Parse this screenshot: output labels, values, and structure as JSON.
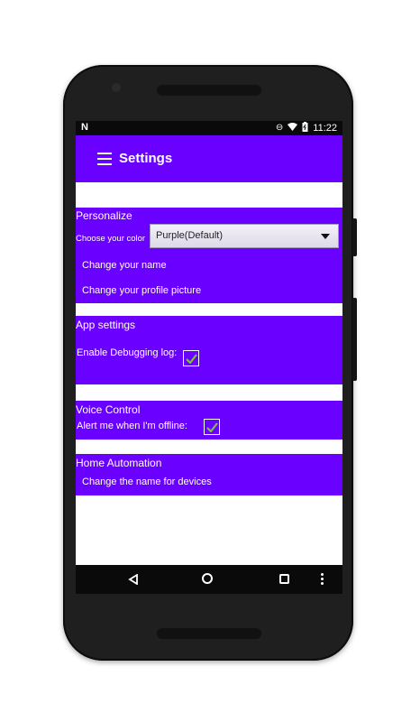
{
  "status_bar": {
    "notification_icon": "N",
    "icons": [
      "do-not-disturb-icon",
      "wifi-icon",
      "battery-icon"
    ],
    "time": "11:22"
  },
  "app_bar": {
    "title": "Settings",
    "menu_icon": "hamburger-menu-icon",
    "background": "#6a00ff"
  },
  "sections": {
    "personalize": {
      "title": "Personalize",
      "color_label": "Choose your color",
      "color_selected": "Purple(Default)",
      "change_name": "Change your name",
      "change_picture": "Change your profile picture"
    },
    "app_settings": {
      "title": "App settings",
      "debug_label": "Enable Debugging log:",
      "debug_checked": true
    },
    "voice_control": {
      "title": "Voice Control",
      "offline_label": "Alert me when I'm offline:",
      "offline_checked": true
    },
    "home_automation": {
      "title": "Home Automation",
      "rename_devices": "Change the name for devices"
    }
  },
  "nav_bar": {
    "buttons": [
      "back-icon",
      "home-icon",
      "recents-icon",
      "overflow-icon"
    ]
  },
  "colors": {
    "accent": "#6a00ff",
    "check": "#7ec236"
  }
}
